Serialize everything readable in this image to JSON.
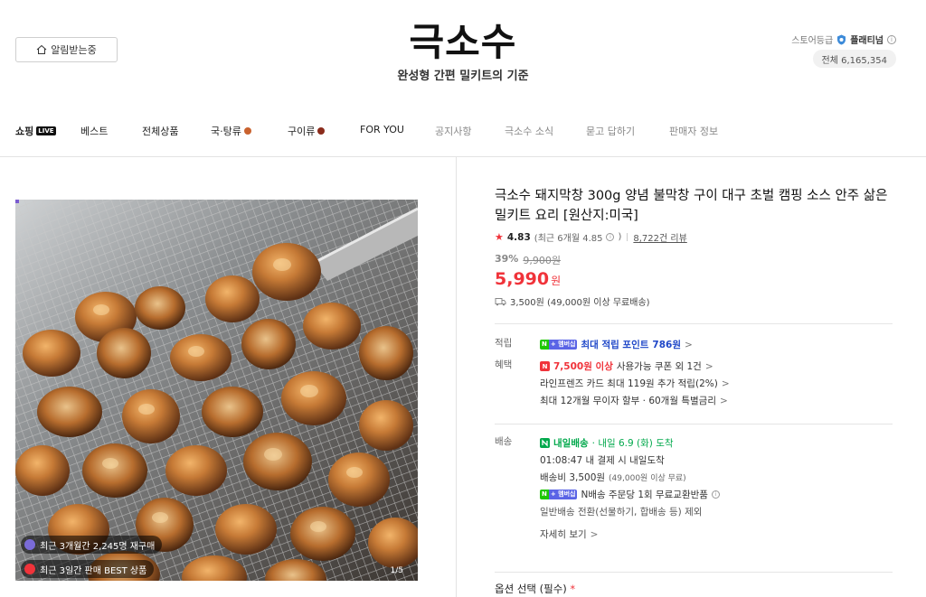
{
  "header": {
    "notif_label": "알림받는중",
    "logo": "극소수",
    "slogan": "완성형 간편 밀키트의 기준",
    "grade_label": "스토어등급",
    "grade_value": "플래티넘",
    "info": "i",
    "visits": "전체 6,165,354"
  },
  "nav": {
    "shopping_label": "쇼핑",
    "live_badge": "LIVE",
    "items": [
      "베스트",
      "전체상품",
      "국·탕류",
      "구이류",
      "FOR YOU",
      "공지사항",
      "극소수 소식",
      "묻고 답하기",
      "판매자 정보"
    ]
  },
  "gallery": {
    "badge_repurchase": "최근 3개월간 2,245명 재구매",
    "badge_best": "최근 3일간 판매 BEST 상품",
    "counter": "1/5"
  },
  "product": {
    "title": "극소수 돼지막창 300g 양념 불막창 구이 대구 초벌 캠핑 소스 안주 삶은 밀키트 요리 [원산지:미국]",
    "rating_star": "★",
    "rating": "4.83",
    "rating_recent": "(최근 6개월 4.85",
    "rating_close": ")",
    "review_count": "8,722건 리뷰",
    "discount_pct": "39%",
    "original_price": "9,900원",
    "price": "5,990",
    "price_unit": "원",
    "shipping": "3,500원 (49,000원 이상 무료배송)"
  },
  "benefits": {
    "points_label": "적립",
    "badge_n": "N",
    "badge_plus": "+ 멤버십",
    "points_prefix": "최대 적립 포인트",
    "points_value": "786원",
    "benefit_label": "혜택",
    "coupon_icon": "N",
    "coupon_amount": "7,500원 이상",
    "coupon_text": "사용가능 쿠폰 외 1건",
    "card_text": "라인프렌즈 카드 최대 119원 추가 적립(2%)",
    "installment_text": "최대 12개월 무이자 할부 · 60개월 특별금리",
    "chevron": ">"
  },
  "delivery": {
    "label": "배송",
    "tomorrow_badge": "내일배송",
    "arrival": "· 내일 6.9 (화) 도착",
    "deadline": "01:08:47  내 결제 시 내일도착",
    "fee": "배송비 3,500원",
    "fee_note": "(49,000원 이상 무료)",
    "exchange": "N배송 주문당 1회 무료교환반품",
    "general": "일반배송 전환(선물하기, 합배송 등) 제외",
    "detail_link": "자세히 보기"
  },
  "options": {
    "label": "옵션 선택 (필수)",
    "required_mark": "*"
  }
}
